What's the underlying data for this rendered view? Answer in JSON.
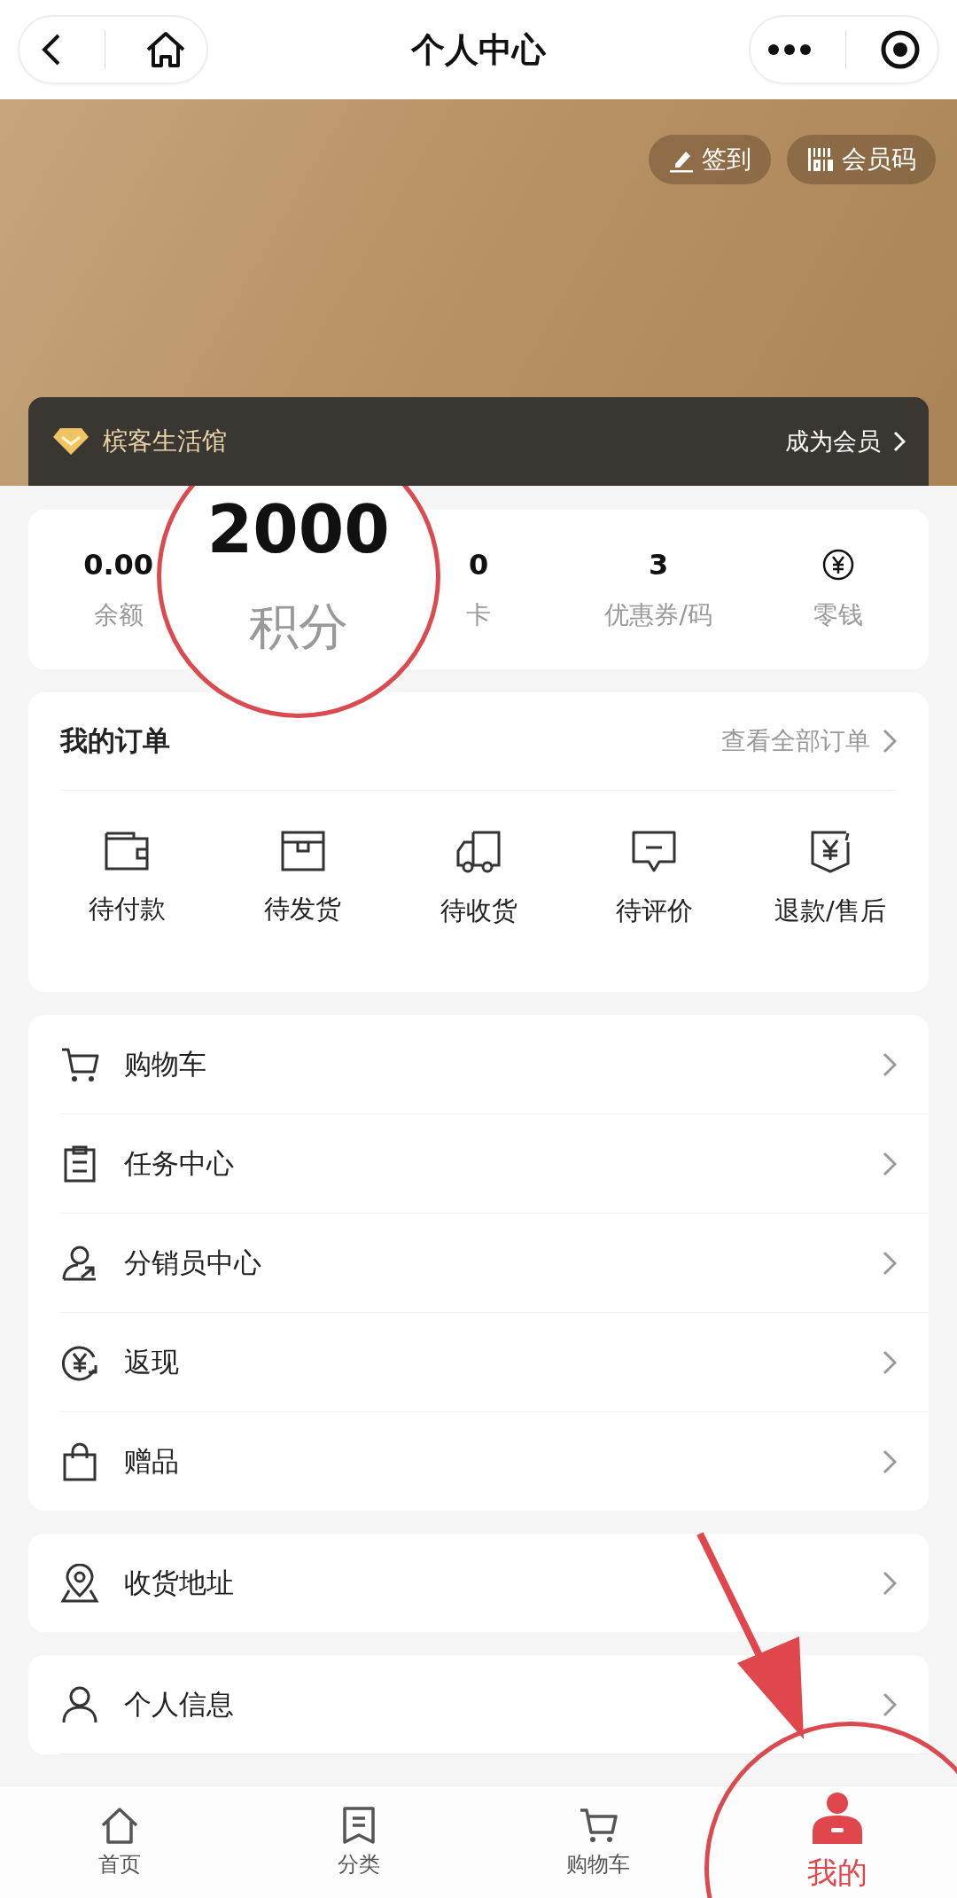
{
  "nav": {
    "title": "个人中心"
  },
  "banner": {
    "buttons": [
      {
        "kind": "checkin",
        "label": "签到"
      },
      {
        "kind": "code",
        "label": "会员码"
      }
    ],
    "store_name": "槟客生活馆",
    "join_label": "成为会员"
  },
  "stats": [
    {
      "kind": "value",
      "value": "0.00",
      "label": "余额",
      "magnified": false
    },
    {
      "kind": "value",
      "value": "2000",
      "label": "积分",
      "magnified": true
    },
    {
      "kind": "value",
      "value": "0",
      "label": "卡",
      "magnified": false
    },
    {
      "kind": "value",
      "value": "3",
      "label": "优惠券/码",
      "magnified": false
    },
    {
      "kind": "icon",
      "label": "零钱",
      "magnified": false
    }
  ],
  "orders": {
    "title": "我的订单",
    "view_all": "查看全部订单",
    "items": [
      {
        "kind": "wallet",
        "label": "待付款"
      },
      {
        "kind": "box",
        "label": "待发货"
      },
      {
        "kind": "truck",
        "label": "待收货"
      },
      {
        "kind": "comment",
        "label": "待评价"
      },
      {
        "kind": "refund",
        "label": "退款/售后"
      }
    ]
  },
  "menu_groups": [
    [
      {
        "kind": "cart",
        "label": "购物车"
      },
      {
        "kind": "clipboard",
        "label": "任务中心"
      },
      {
        "kind": "share",
        "label": "分销员中心"
      },
      {
        "kind": "cash",
        "label": "返现"
      },
      {
        "kind": "bag",
        "label": "赠品"
      }
    ],
    [
      {
        "kind": "pin",
        "label": "收货地址"
      }
    ],
    [
      {
        "kind": "person",
        "label": "个人信息"
      }
    ]
  ],
  "tabbar": [
    {
      "kind": "home",
      "label": "首页",
      "selected": false
    },
    {
      "kind": "list",
      "label": "分类",
      "selected": false
    },
    {
      "kind": "cart",
      "label": "购物车",
      "selected": false
    },
    {
      "kind": "user",
      "label": "我的",
      "selected": true
    }
  ]
}
